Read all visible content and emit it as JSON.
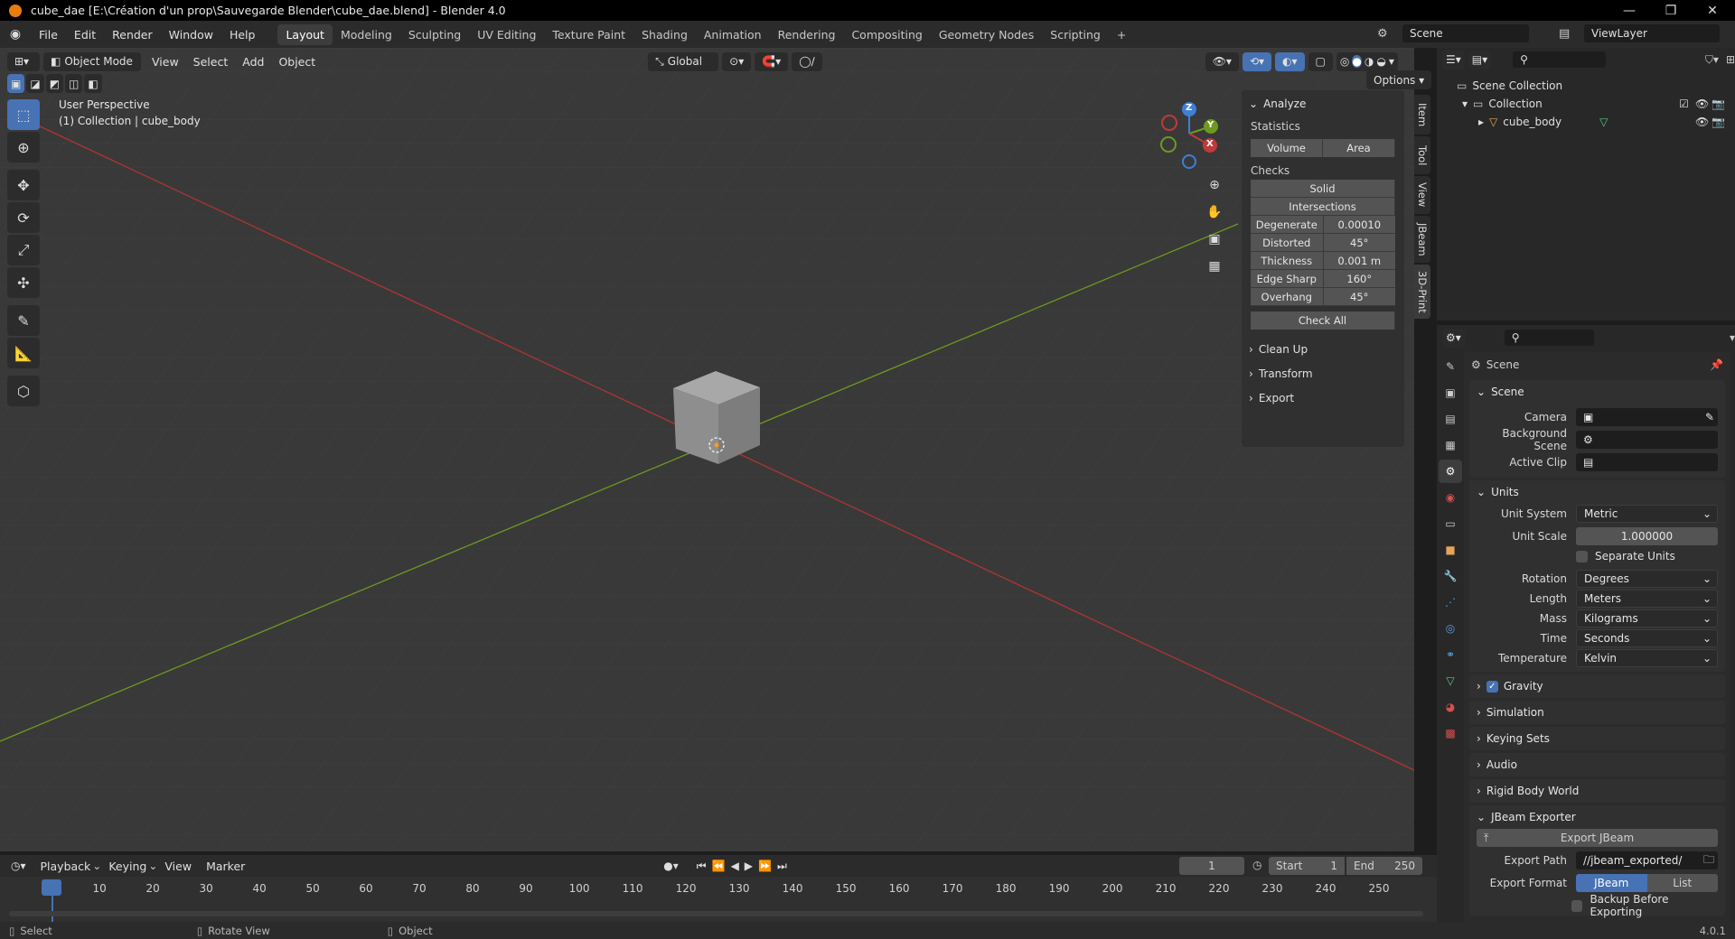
{
  "window": {
    "title": "cube_dae [E:\\Création d'un prop\\Sauvegarde Blender\\cube_dae.blend] - Blender 4.0"
  },
  "menubar": {
    "menus": [
      "File",
      "Edit",
      "Render",
      "Window",
      "Help"
    ],
    "workspaces": [
      "Layout",
      "Modeling",
      "Sculpting",
      "UV Editing",
      "Texture Paint",
      "Shading",
      "Animation",
      "Rendering",
      "Compositing",
      "Geometry Nodes",
      "Scripting"
    ],
    "active_workspace": "Layout",
    "add_tab": "+",
    "scene_name": "Scene",
    "view_layer": "ViewLayer"
  },
  "viewport": {
    "mode": "Object Mode",
    "menus": [
      "View",
      "Select",
      "Add",
      "Object"
    ],
    "orientation": "Global",
    "options_label": "Options",
    "perspective_label": "User Perspective",
    "collection_label": "(1) Collection | cube_body",
    "gizmo_axes": [
      "Z",
      "Y",
      "X"
    ]
  },
  "npanel": {
    "tabs": [
      "Item",
      "Tool",
      "View",
      "JBeam",
      "3D-Print"
    ],
    "active_tab": "3D-Print",
    "analyze_title": "Analyze",
    "statistics_label": "Statistics",
    "stat_buttons": [
      "Volume",
      "Area"
    ],
    "checks_label": "Checks",
    "solid_label": "Solid",
    "intersections_label": "Intersections",
    "checks": [
      {
        "label": "Degenerate",
        "value": "0.00010"
      },
      {
        "label": "Distorted",
        "value": "45°"
      },
      {
        "label": "Thickness",
        "value": "0.001 m"
      },
      {
        "label": "Edge Sharp",
        "value": "160°"
      },
      {
        "label": "Overhang",
        "value": "45°"
      }
    ],
    "check_all_label": "Check All",
    "collapsed_sections": [
      "Clean Up",
      "Transform",
      "Export"
    ]
  },
  "outliner": {
    "scene_collection": "Scene Collection",
    "collection": "Collection",
    "object": "cube_body"
  },
  "properties": {
    "header": "Scene",
    "scene_section": {
      "title": "Scene",
      "camera_label": "Camera",
      "camera_value": "",
      "background_label": "Background Scene",
      "background_value": "",
      "clip_label": "Active Clip",
      "clip_value": ""
    },
    "units_section": {
      "title": "Units",
      "unit_system_label": "Unit System",
      "unit_system": "Metric",
      "unit_scale_label": "Unit Scale",
      "unit_scale": "1.000000",
      "separate_units": "Separate Units",
      "rotation_label": "Rotation",
      "rotation": "Degrees",
      "length_label": "Length",
      "length": "Meters",
      "mass_label": "Mass",
      "mass": "Kilograms",
      "time_label": "Time",
      "time": "Seconds",
      "temperature_label": "Temperature",
      "temperature": "Kelvin"
    },
    "collapsed_sections": [
      "Gravity",
      "Simulation",
      "Keying Sets",
      "Audio",
      "Rigid Body World"
    ],
    "jbeam_section": {
      "title": "JBeam Exporter",
      "export_button": "Export JBeam",
      "export_path_label": "Export Path",
      "export_path": "//jbeam_exported/",
      "export_format_label": "Export Format",
      "format_options": [
        "JBeam",
        "List"
      ],
      "backup_label": "Backup Before Exporting"
    }
  },
  "timeline": {
    "menus": [
      "Playback",
      "Keying",
      "View",
      "Marker"
    ],
    "current_frame": "1",
    "start_label": "Start",
    "start": "1",
    "end_label": "End",
    "end": "250",
    "ticks": [
      "1",
      "10",
      "20",
      "30",
      "40",
      "50",
      "60",
      "70",
      "80",
      "90",
      "100",
      "110",
      "120",
      "130",
      "140",
      "150",
      "160",
      "170",
      "180",
      "190",
      "200",
      "210",
      "220",
      "230",
      "240",
      "250"
    ]
  },
  "statusbar": {
    "items": [
      "Select",
      "Rotate View",
      "Object"
    ],
    "version": "4.0.1"
  },
  "colors": {
    "accent": "#4772b3",
    "x_axis": "#c03a3a",
    "y_axis": "#6d9a1e",
    "z_axis": "#3f7fd6",
    "blender_orange": "#e87d0d"
  }
}
